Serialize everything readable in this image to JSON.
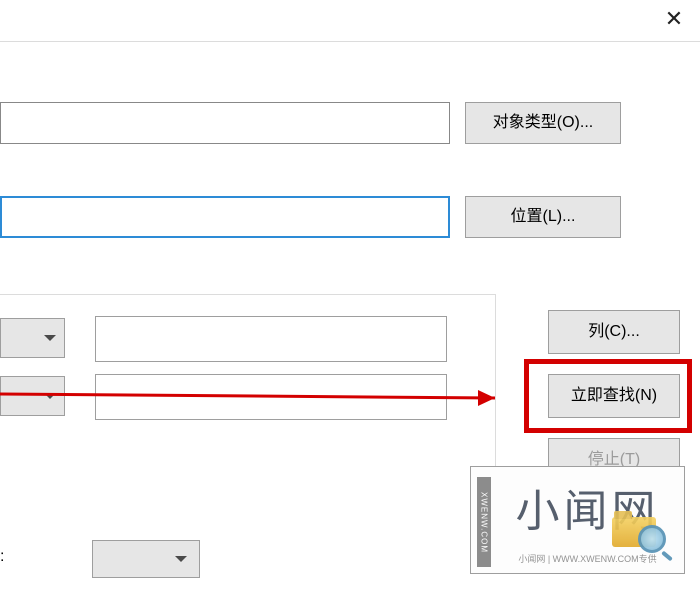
{
  "close_label": "✕",
  "object_type_button": "对象类型(O)...",
  "location_button": "位置(L)...",
  "columns_button": "列(C)...",
  "find_now_button": "立即查找(N)",
  "stop_button": "停止(T)",
  "watermark": {
    "side": "XWENW.COM",
    "main": "小闻网",
    "sub": "小闻网 | WWW.XWENW.COM专供"
  }
}
